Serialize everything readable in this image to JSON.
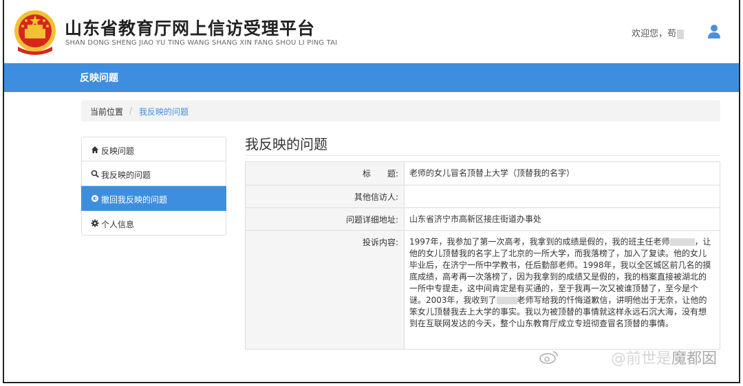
{
  "header": {
    "title": "山东省教育厅网上信访受理平台",
    "subtitle": "SHAN DONG SHENG JIAO YU TING WANG SHANG XIN FANG SHOU LI PING TAI",
    "welcome": "欢迎您，苟",
    "emblem_icon": "national-emblem-icon",
    "user_icon": "user-icon"
  },
  "navbar": {
    "title": "反映问题"
  },
  "breadcrumb": {
    "label": "当前位置",
    "separator": "/",
    "current": "我反映的问题"
  },
  "sidebar": {
    "items": [
      {
        "label": "反映问题",
        "icon": "home-icon",
        "active": false
      },
      {
        "label": "我反映的问题",
        "icon": "search-icon",
        "active": false
      },
      {
        "label": "撤回我反映的问题",
        "icon": "revoke-icon",
        "active": true
      },
      {
        "label": "个人信息",
        "icon": "gear-icon",
        "active": false
      }
    ]
  },
  "main": {
    "title": "我反映的问题",
    "rows": [
      {
        "label": "标　　题:",
        "value": "老师的女儿冒名顶替上大学（顶替我的名字）"
      },
      {
        "label": "其他信访人:",
        "value": ""
      },
      {
        "label": "问题详细地址:",
        "value": "山东省济宁市高新区接庄街道办事处"
      },
      {
        "label": "投诉内容:",
        "value_parts": [
          "1997年，我参加了第一次高考，我拿到的成绩是假的，我的班主任老师",
          "，让他的女儿顶替我的名字上了北京的一所大学，而我落榜了，加入了复读。他的女儿毕业后，在济宁一所中学教书，任后勤部老师。1998年，我以全区城区前几名的摸底成绩，高考再一次落榜了，因为我拿到的成绩又是假的，我的档案直接被湖北的一所中专提走，这中间肯定是有买通的，至于我再一次又被谁顶替了，至今是个谜。2003年，我收到了",
          "老师写给我的忏悔道歉信，讲明他出于无奈，让他的笨女儿顶替我去上大学的事实。我以为被顶替的事情就这样永远石沉大海，没有想到在互联网发达的今天，整个山东教育厅成立专班彻查冒名顶替的事情。"
        ]
      }
    ]
  },
  "watermark": {
    "prefix": "@前世是",
    "suffix": "魔都囡"
  },
  "colors": {
    "accent": "#3e8ee0",
    "emblem_red": "#d7261e",
    "emblem_gold": "#f2c033"
  }
}
